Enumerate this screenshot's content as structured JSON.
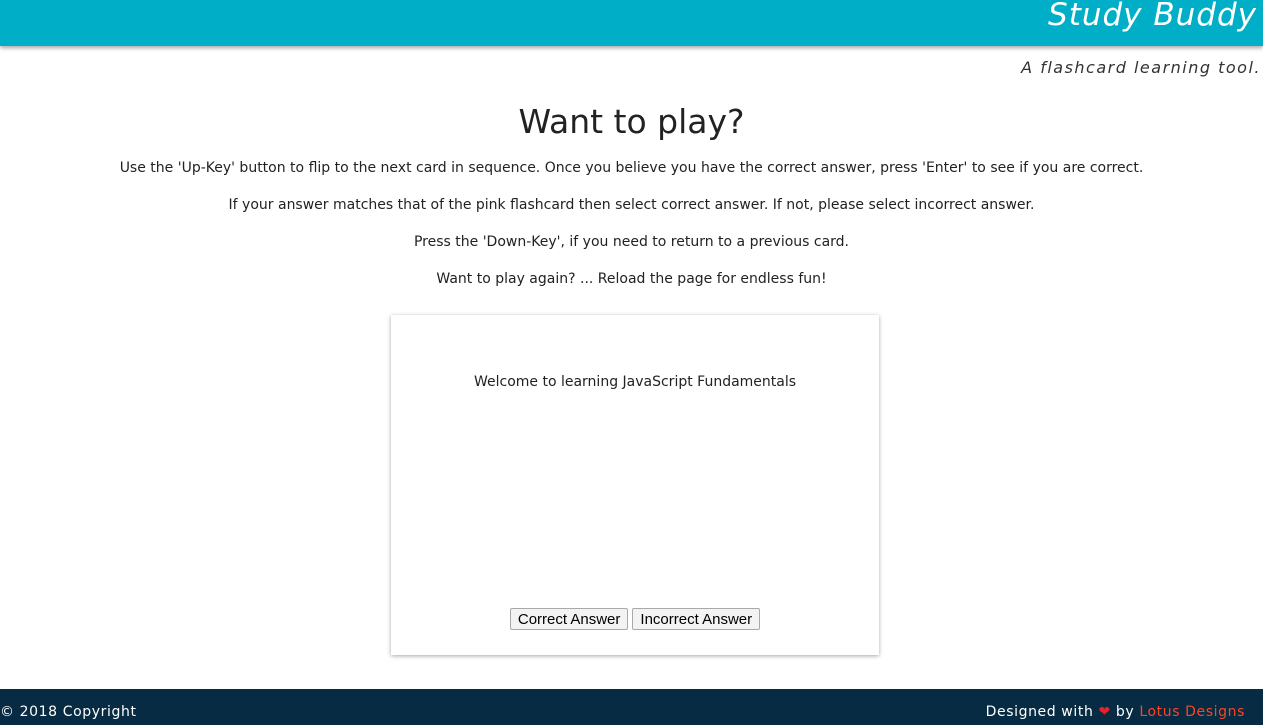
{
  "header": {
    "app_title": "Study Buddy",
    "tagline": "A flashcard learning tool.",
    "color": "#00afc7"
  },
  "main": {
    "title": "Want to play?",
    "instructions": [
      "Use the 'Up-Key' button to flip to the next card in sequence. Once you believe you have the correct answer, press 'Enter' to see if you are correct.",
      "If your answer matches that of the pink flashcard then select correct answer. If not, please select incorrect answer.",
      "Press the 'Down-Key', if you need to return to a previous card.",
      "Want to play again? ... Reload the page for endless fun!"
    ]
  },
  "card": {
    "text": "Welcome to learning JavaScript Fundamentals",
    "correct_label": "Correct Answer",
    "incorrect_label": "Incorrect Answer"
  },
  "footer": {
    "copyright": "© 2018 Copyright",
    "designed_with": "Designed with",
    "heart_icon": "❤",
    "by": "by",
    "designer": "Lotus Designs",
    "background": "#062b42",
    "link_color": "#ff4423"
  }
}
